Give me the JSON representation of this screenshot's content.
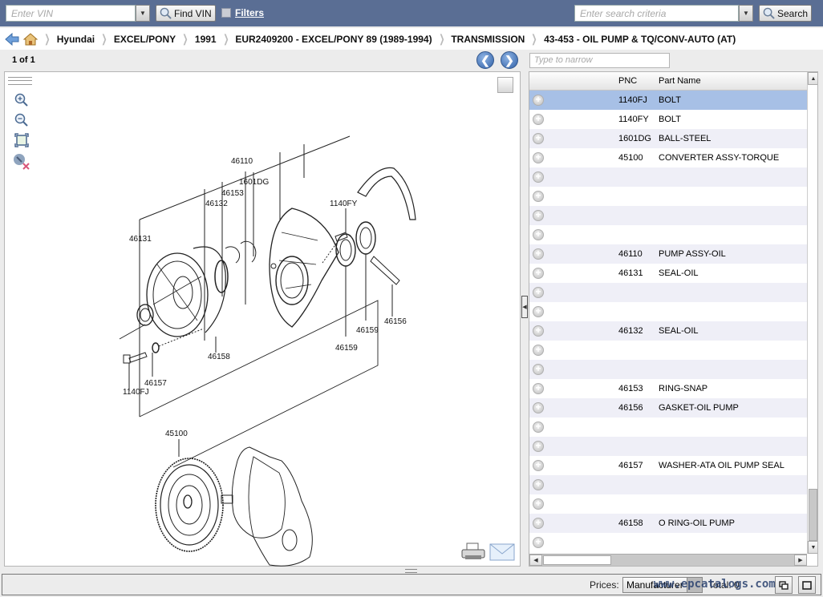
{
  "topbar": {
    "vin_placeholder": "Enter VIN",
    "find_vin_label": "Find VIN",
    "filters_label": "Filters",
    "search_placeholder": "Enter search criteria",
    "search_label": "Search"
  },
  "breadcrumb": {
    "items": [
      "Hyundai",
      "EXCEL/PONY",
      "1991",
      "EUR2409200 - EXCEL/PONY 89 (1989-1994)",
      "TRANSMISSION",
      "43-453 - OIL PUMP & TQ/CONV-AUTO (AT)"
    ]
  },
  "pager": {
    "page_text": "1 of 1"
  },
  "narrow": {
    "placeholder": "Type to narrow"
  },
  "diagram": {
    "callouts": [
      "1140FY",
      "46110",
      "1601DG",
      "46153",
      "46132",
      "46131",
      "46159",
      "46156",
      "46159",
      "46158",
      "46157",
      "1140FJ",
      "45100"
    ]
  },
  "parts_table": {
    "columns": [
      "PNC",
      "Part Name"
    ],
    "rows": [
      {
        "pnc": "1140FJ",
        "name": "BOLT",
        "selected": true
      },
      {
        "pnc": "1140FY",
        "name": "BOLT"
      },
      {
        "pnc": "1601DG",
        "name": "BALL-STEEL"
      },
      {
        "pnc": "45100",
        "name": "CONVERTER ASSY-TORQUE"
      },
      {
        "pnc": "",
        "name": ""
      },
      {
        "pnc": "",
        "name": ""
      },
      {
        "pnc": "",
        "name": ""
      },
      {
        "pnc": "",
        "name": ""
      },
      {
        "pnc": "46110",
        "name": "PUMP ASSY-OIL"
      },
      {
        "pnc": "46131",
        "name": "SEAL-OIL"
      },
      {
        "pnc": "",
        "name": ""
      },
      {
        "pnc": "",
        "name": ""
      },
      {
        "pnc": "46132",
        "name": "SEAL-OIL"
      },
      {
        "pnc": "",
        "name": ""
      },
      {
        "pnc": "",
        "name": ""
      },
      {
        "pnc": "46153",
        "name": "RING-SNAP"
      },
      {
        "pnc": "46156",
        "name": "GASKET-OIL PUMP"
      },
      {
        "pnc": "",
        "name": ""
      },
      {
        "pnc": "",
        "name": ""
      },
      {
        "pnc": "46157",
        "name": "WASHER-ATA OIL PUMP SEAL"
      },
      {
        "pnc": "",
        "name": ""
      },
      {
        "pnc": "",
        "name": ""
      },
      {
        "pnc": "46158",
        "name": "O RING-OIL PUMP"
      },
      {
        "pnc": "",
        "name": ""
      }
    ]
  },
  "statusbar": {
    "prices_label": "Prices:",
    "prices_value": "Manufacturer",
    "total_label": "Total: 0",
    "watermark": "www.epcatalogs.com"
  }
}
